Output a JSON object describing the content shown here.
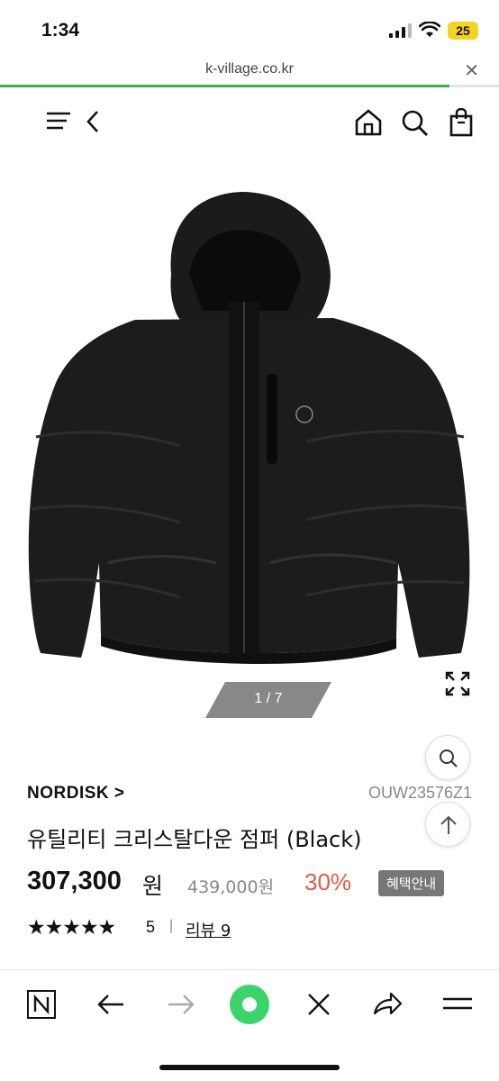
{
  "status_bar": {
    "time": "1:34",
    "battery": "25"
  },
  "browser": {
    "url": "k-village.co.kr",
    "close": "✕",
    "progress": 0.9
  },
  "header": {
    "icons": [
      "menu-icon",
      "back-icon",
      "home-icon",
      "search-icon",
      "shopping-bag-icon"
    ]
  },
  "gallery": {
    "pager": "1 / 7"
  },
  "product": {
    "brand": "NORDISK >",
    "code": "OUW23576Z1",
    "name": "유틸리티 크리스탈다운 점퍼 (Black)",
    "price": "307,300",
    "currency": "원",
    "original_price": "439,000원",
    "discount": "30%",
    "benefit_button": "혜택안내",
    "stars": "★★★★★",
    "rating": "5",
    "separator": "|",
    "review_link": "리뷰 9"
  },
  "toolbar": {
    "items": [
      "naver-icon",
      "back-arrow-icon",
      "forward-arrow-icon",
      "green-dot-icon",
      "close-icon",
      "share-icon",
      "menu-lines-icon"
    ]
  },
  "colors": {
    "accent_green": "#3cb043",
    "discount_red": "#e25b45",
    "badge_gray": "#777777"
  }
}
